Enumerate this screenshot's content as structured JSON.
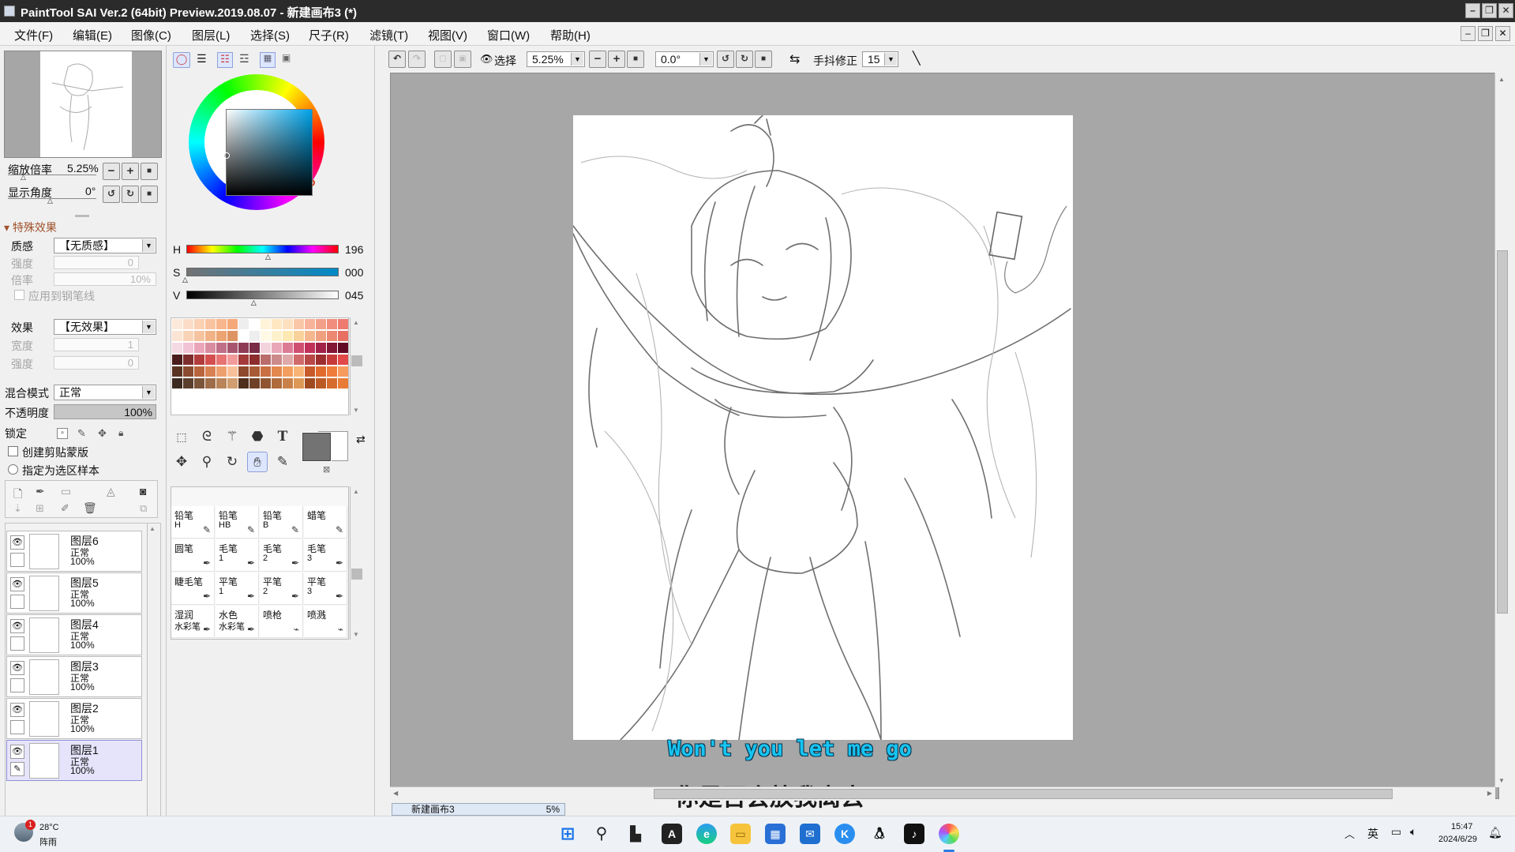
{
  "window": {
    "title": "PaintTool SAI Ver.2 (64bit) Preview.2019.08.07 - 新建画布3 (*)",
    "min": "–",
    "max": "❐",
    "close": "✕"
  },
  "menu": [
    "文件(F)",
    "编辑(E)",
    "图像(C)",
    "图层(L)",
    "选择(S)",
    "尺子(R)",
    "滤镜(T)",
    "视图(V)",
    "窗口(W)",
    "帮助(H)"
  ],
  "navigator": {
    "zoom_label": "缩放倍率",
    "zoom_value": "5.25%",
    "angle_label": "显示角度",
    "angle_value": "0°"
  },
  "effects": {
    "header": "特殊效果",
    "texture_label": "质感",
    "texture_value": "【无质感】",
    "strength_label": "强度",
    "strength_value": "0",
    "scale_label": "倍率",
    "scale_value": "10%",
    "apply_to_pen": "应用到钢笔线",
    "effect_label": "效果",
    "effect_value": "【无效果】",
    "width_label": "宽度",
    "width_value": "1",
    "effect_strength_label": "强度",
    "effect_strength_value": "0"
  },
  "blend": {
    "label": "混合模式",
    "value": "正常",
    "opacity_label": "不透明度",
    "opacity_value": "100%",
    "opacity": 1.0
  },
  "lock": {
    "label": "锁定",
    "clip": "创建剪贴蒙版",
    "sample": "指定为选区样本"
  },
  "layers": [
    {
      "name": "图层6",
      "mode": "正常",
      "opacity": "100%",
      "selected": false
    },
    {
      "name": "图层5",
      "mode": "正常",
      "opacity": "100%",
      "selected": false
    },
    {
      "name": "图层4",
      "mode": "正常",
      "opacity": "100%",
      "selected": false
    },
    {
      "name": "图层3",
      "mode": "正常",
      "opacity": "100%",
      "selected": false
    },
    {
      "name": "图层2",
      "mode": "正常",
      "opacity": "100%",
      "selected": false
    },
    {
      "name": "图层1",
      "mode": "正常",
      "opacity": "100%",
      "selected": true
    }
  ],
  "color": {
    "H_label": "H",
    "H": "196",
    "S_label": "S",
    "S": "000",
    "V_label": "V",
    "V": "045",
    "h_frac": 0.544,
    "s_frac": 0.0,
    "v_frac": 0.45,
    "current": "#737373"
  },
  "brushes": [
    {
      "name": "铅笔",
      "sub": "H"
    },
    {
      "name": "铅笔",
      "sub": "HB"
    },
    {
      "name": "铅笔",
      "sub": "B"
    },
    {
      "name": "蜡笔",
      "sub": ""
    },
    {
      "name": "圆笔",
      "sub": ""
    },
    {
      "name": "毛笔",
      "sub": "1"
    },
    {
      "name": "毛笔",
      "sub": "2"
    },
    {
      "name": "毛笔",
      "sub": "3"
    },
    {
      "name": "睫毛笔",
      "sub": ""
    },
    {
      "name": "平笔",
      "sub": "1"
    },
    {
      "name": "平笔",
      "sub": "2"
    },
    {
      "name": "平笔",
      "sub": "3"
    },
    {
      "name": "湿润",
      "sub": "水彩笔"
    },
    {
      "name": "水色",
      "sub": "水彩笔"
    },
    {
      "name": "喷枪",
      "sub": ""
    },
    {
      "name": "喷溅",
      "sub": ""
    }
  ],
  "toolbar": {
    "select_label": "选择",
    "zoom": "5.25%",
    "angle": "0.0°",
    "stabilizer_label": "手抖修正",
    "stabilizer": "15"
  },
  "subtitles": {
    "en": "Won't you let me go",
    "zh": "你是否会放我离去"
  },
  "doc_tab": {
    "name": "新建画布3",
    "zoom": "5%"
  },
  "taskbar": {
    "temp": "28°C",
    "weather": "阵雨",
    "badge": "1",
    "ime": "英",
    "time": "15:47",
    "date": "2024/6/29"
  }
}
